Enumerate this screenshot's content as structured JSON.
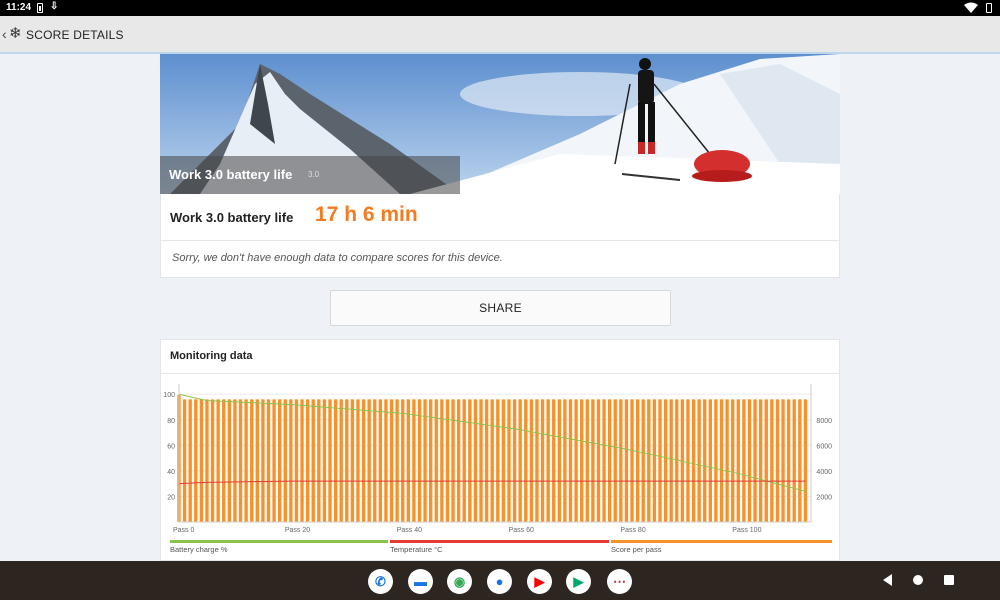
{
  "status_bar": {
    "time": "11:24"
  },
  "app_bar": {
    "back_icon": "chevron-left-icon",
    "app_icon": "snowflake-icon",
    "title": "SCORE DETAILS"
  },
  "hero": {
    "test_name": "Work 3.0 battery life",
    "version": "3.0"
  },
  "result": {
    "label": "Work 3.0 battery life",
    "value": "17 h 6 min",
    "message": "Sorry, we don't have enough data to compare scores for this device."
  },
  "share": {
    "label": "SHARE"
  },
  "monitoring": {
    "title": "Monitoring data",
    "legend": [
      {
        "label": "Battery charge %",
        "color": "#8bc34a"
      },
      {
        "label": "Temperature °C",
        "color": "#e53935"
      },
      {
        "label": "Score per pass",
        "color": "#f7922b"
      }
    ]
  },
  "chart_data": {
    "type": "bar",
    "x_tick_labels": [
      "Pass 0",
      "Pass 20",
      "Pass 40",
      "Pass 60",
      "Pass 80",
      "Pass 100"
    ],
    "x_ticks": [
      0,
      20,
      40,
      60,
      80,
      100
    ],
    "xlim": [
      0,
      113
    ],
    "y_left_ticks": [
      100,
      80,
      60,
      40,
      20
    ],
    "y_left_lim": [
      0,
      108
    ],
    "y_right_ticks": [
      8000,
      6000,
      4000,
      2000
    ],
    "y_right_lim": [
      0,
      10800
    ],
    "grid": true,
    "legend_position": "bottom",
    "series": [
      {
        "name": "Score per pass",
        "axis": "right",
        "type": "bar",
        "color": "#f7922b",
        "x_range": [
          0,
          112
        ],
        "typical_value": 9600,
        "first_value": 9950
      },
      {
        "name": "Battery charge %",
        "axis": "left",
        "type": "line",
        "color": "#8bc34a",
        "points": [
          [
            0,
            100
          ],
          [
            5,
            95
          ],
          [
            20,
            92
          ],
          [
            40,
            85
          ],
          [
            60,
            73
          ],
          [
            80,
            57
          ],
          [
            100,
            38
          ],
          [
            112,
            24
          ]
        ]
      },
      {
        "name": "Temperature °C",
        "axis": "left",
        "type": "line",
        "color": "#e53935",
        "points": [
          [
            0,
            30
          ],
          [
            5,
            31
          ],
          [
            20,
            32
          ],
          [
            40,
            32
          ],
          [
            60,
            32
          ],
          [
            80,
            32
          ],
          [
            100,
            32
          ],
          [
            112,
            32
          ]
        ]
      }
    ]
  },
  "dock": [
    {
      "name": "phone-app-icon",
      "glyph": "✆",
      "color": "#1a73e8"
    },
    {
      "name": "messages-app-icon",
      "glyph": "▬",
      "color": "#1a73e8"
    },
    {
      "name": "chrome-app-icon",
      "glyph": "◉",
      "color": "#34a853"
    },
    {
      "name": "contacts-app-icon",
      "glyph": "●",
      "color": "#1a73e8"
    },
    {
      "name": "youtube-app-icon",
      "glyph": "▶",
      "color": "#ff0000"
    },
    {
      "name": "play-store-app-icon",
      "glyph": "▶",
      "color": "#00a86b"
    },
    {
      "name": "app-drawer-icon",
      "glyph": "⋯",
      "color": "#c62828"
    }
  ]
}
